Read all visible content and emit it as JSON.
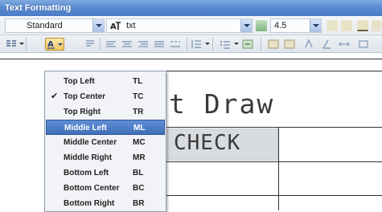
{
  "window": {
    "title": "Text Formatting"
  },
  "toolbar_top": {
    "style_value": "Standard",
    "font_value": "txt",
    "height_value": "4.5"
  },
  "toolbar_format": {
    "justify_button_icon": "justify-a-icon",
    "buttons": [
      "paragraph-icon",
      "align-left-icon",
      "align-center-icon",
      "align-right-icon",
      "justify-icon",
      "distribute-icon",
      "line-spacing-icon",
      "numbering-icon",
      "insert-field-icon",
      "uppercase-icon",
      "lowercase-icon"
    ]
  },
  "drawing": {
    "title_text": "t Draw",
    "cell_text": "CHECK"
  },
  "justification_menu": {
    "items": [
      {
        "label": "Top Left",
        "code": "TL",
        "checked": false,
        "highlighted": false
      },
      {
        "label": "Top Center",
        "code": "TC",
        "checked": true,
        "highlighted": false
      },
      {
        "label": "Top Right",
        "code": "TR",
        "checked": false,
        "highlighted": false
      },
      {
        "label": "Middle Left",
        "code": "ML",
        "checked": false,
        "highlighted": true
      },
      {
        "label": "Middle Center",
        "code": "MC",
        "checked": false,
        "highlighted": false
      },
      {
        "label": "Middle Right",
        "code": "MR",
        "checked": false,
        "highlighted": false
      },
      {
        "label": "Bottom Left",
        "code": "BL",
        "checked": false,
        "highlighted": false
      },
      {
        "label": "Bottom Center",
        "code": "BC",
        "checked": false,
        "highlighted": false
      },
      {
        "label": "Bottom Right",
        "code": "BR",
        "checked": false,
        "highlighted": false
      }
    ],
    "check_glyph": "✔"
  },
  "colors": {
    "titlebar": "#5b8bd0",
    "highlight": "#4a7cc6",
    "cell_fill": "#d9dcdf"
  }
}
